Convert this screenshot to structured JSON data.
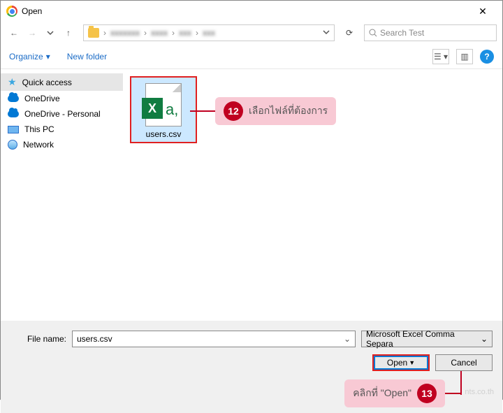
{
  "window": {
    "title": "Open"
  },
  "nav": {
    "search_placeholder": "Search Test"
  },
  "toolbar": {
    "organize": "Organize",
    "new_folder": "New folder"
  },
  "sidebar": {
    "items": [
      {
        "label": "Quick access"
      },
      {
        "label": "OneDrive"
      },
      {
        "label": "OneDrive - Personal"
      },
      {
        "label": "This PC"
      },
      {
        "label": "Network"
      }
    ]
  },
  "file": {
    "name": "users.csv",
    "badge": "X",
    "suffix": "a,"
  },
  "footer": {
    "filename_label": "File name:",
    "filename_value": "users.csv",
    "filetype": "Microsoft Excel Comma Separa",
    "open": "Open",
    "cancel": "Cancel"
  },
  "annotations": {
    "a12": {
      "num": "12",
      "text": "เลือกไฟล์ที่ต้องการ"
    },
    "a13": {
      "num": "13",
      "text": "คลิกที่ \"Open\""
    }
  },
  "watermark": "nts.co.th"
}
